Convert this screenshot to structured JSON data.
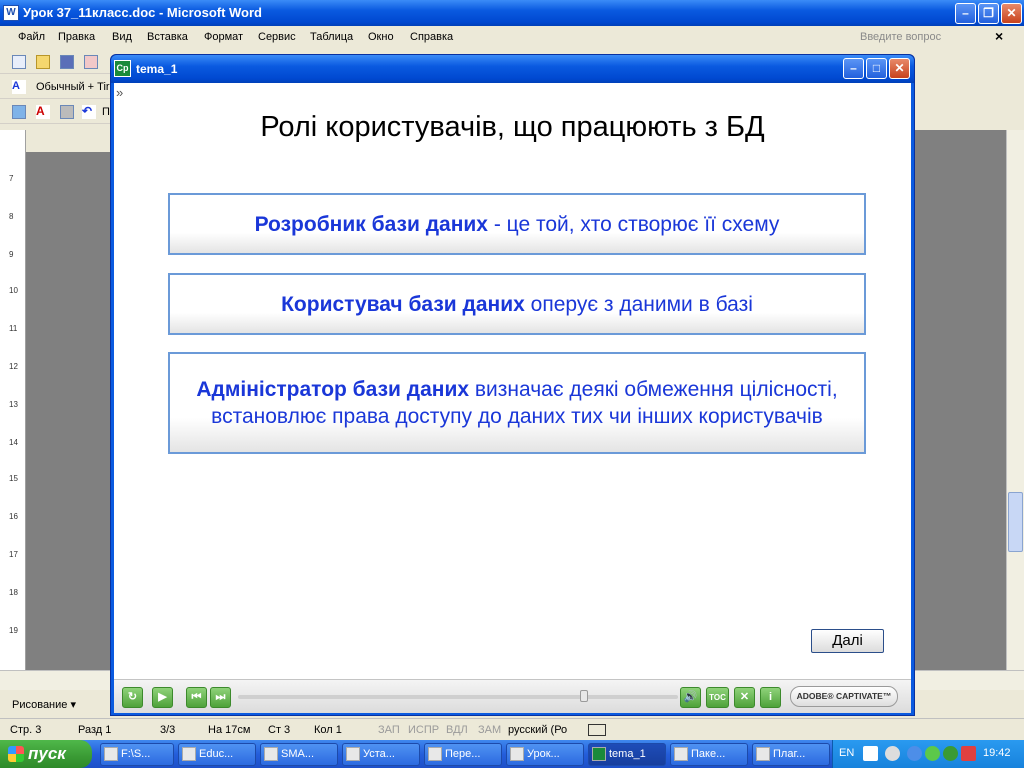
{
  "word": {
    "title": "Урок 37_11класс.doc - Microsoft Word",
    "menu": [
      "Файл",
      "Правка",
      "Вид",
      "Вставка",
      "Формат",
      "Сервис",
      "Таблица",
      "Окно",
      "Справка"
    ],
    "ask_placeholder": "Введите вопрос",
    "style_box": "Обычный + Tir",
    "toolbar3_text": "П",
    "ruler_numbers": [
      "7",
      "8",
      "9",
      "10",
      "11",
      "12",
      "13",
      "14",
      "15",
      "16",
      "17",
      "18",
      "19"
    ],
    "draw_label": "Рисование ▾",
    "status": {
      "page": "Стр. 3",
      "section": "Разд 1",
      "pages": "3/3",
      "at": "На 17см",
      "line": "Ст 3",
      "col": "Кол 1",
      "rec": "ЗАП",
      "trk": "ИСПР",
      "ext": "ВДЛ",
      "ovr": "ЗАМ",
      "lang": "русский (Ро"
    }
  },
  "captivate": {
    "window_title": "tema_1",
    "icon_text": "Cp",
    "slide_title": "Ролі користувачів, що працюють з БД",
    "boxes": [
      {
        "bold": "Розробник бази даних",
        "text": " - це той, хто створює її схему"
      },
      {
        "bold": "Користувач бази даних",
        "text": " оперує з даними в базі"
      },
      {
        "bold": "Адміністратор бази даних",
        "text": " визначає деякі обмеження цілісності, встановлює права доступу до даних тих чи інших користувачів"
      }
    ],
    "next_button": "Далі",
    "toc_label": "TOC",
    "adobe_label": "ADOBE® CAPTIVATE™"
  },
  "taskbar": {
    "start": "пуск",
    "tasks": [
      "F:\\S...",
      "Educ...",
      "SMA...",
      "Уста...",
      "Пере...",
      "Урок...",
      "tema_1",
      "Паке...",
      "Плаг..."
    ],
    "lang": "EN",
    "clock": "19:42"
  },
  "colors": {
    "accent_blue": "#1a37d8",
    "xp_blue": "#0a5ae0",
    "start_green": "#3a9a34"
  }
}
